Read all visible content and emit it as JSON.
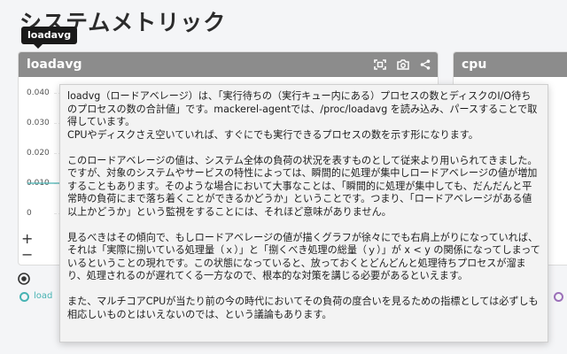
{
  "page": {
    "title": "システムメトリック"
  },
  "tooltip_pill": {
    "label": "loadavg"
  },
  "panels": [
    {
      "title": "loadavg",
      "y_ticks": [
        "0.040",
        "0.030",
        "0.020",
        "0.010",
        "0"
      ]
    },
    {
      "title": "cpu"
    }
  ],
  "zoom": {
    "plus": "+",
    "minus": "−"
  },
  "legend": {
    "loadavg_label": "load",
    "loadavg_color": "#47b3b3",
    "cpu_color": "#9b6fb8"
  },
  "description": {
    "paragraphs": [
      "loadvg（ロードアベレージ）は、「実行待ちの（実行キュー内にある）プロセスの数とディスクのI/O待ちのプロセスの数の合計値」です。mackerel-agentでは、/proc/loadavg を読み込み、パースすることで取得しています。\nCPUやディスクさえ空いていれば、すぐにでも実行できるプロセスの数を示す形になります。",
      "このロードアベレージの値は、システム全体の負荷の状況を表すものとして従来より用いられてきました。ですが、対象のシステムやサービスの特性によっては、瞬間的に処理が集中しロードアベレージの値が増加することもあります。そのような場合において大事なことは、「瞬間的に処理が集中しても、だんだんと平常時の負荷にまで落ち着くことができるかどうか」ということです。つまり、「ロードアベレージがある値以上かどうか」という監視をすることには、それほど意味がありません。",
      "見るべきはその傾向で、もしロードアベレージの値が描くグラフが徐々にでも右肩上がりになっていれば、それは「実際に捌いている処理量（ｘ）」と「捌くべき処理の総量（ｙ）」が x < y の関係になってしまっているということの現れです。この状態になっていると、放っておくとどんどんと処理待ちプロセスが溜まり、処理されるのが遅れてくる一方なので、根本的な対策を講じる必要があるといえます。",
      "また、マルチコアCPUが当たり前の今の時代においてその負荷の度合いを見るための指標としては必ずしも相応しいものとはいえないのでは、という議論もあります。"
    ]
  }
}
